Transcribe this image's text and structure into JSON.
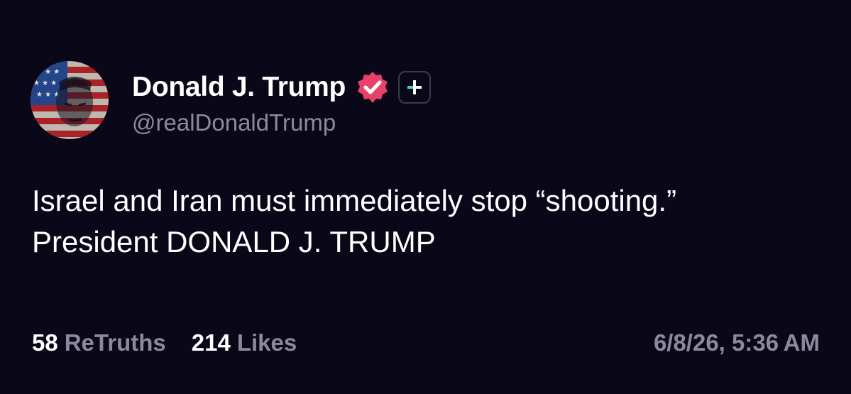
{
  "author": {
    "display_name": "Donald J. Trump",
    "handle": "@realDonaldTrump",
    "avatar_icon": "flag-portrait-avatar",
    "verified_icon": "verified-badge-icon",
    "verified_color": "#e8416a",
    "plus_icon": "plus-badge-icon",
    "plus_color": "#3ddab4"
  },
  "post": {
    "lines": [
      "Israel and Iran must immediately stop “shooting.”",
      "President DONALD J. TRUMP"
    ]
  },
  "stats": {
    "retruths_count": "58",
    "retruths_label": "ReTruths",
    "likes_count": "214",
    "likes_label": "Likes"
  },
  "timestamp": "6/8/26, 5:36 AM",
  "colors": {
    "background": "#0a0818",
    "text_primary": "#ffffff",
    "text_secondary": "#8b8a9c"
  }
}
